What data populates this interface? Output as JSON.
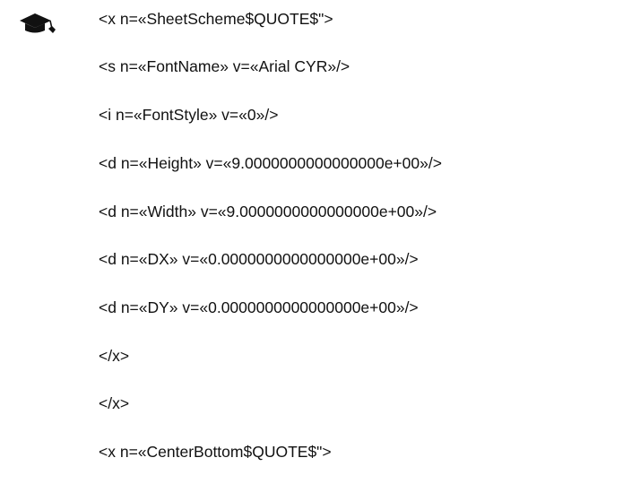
{
  "document": {
    "icon": "graduation-cap-icon",
    "lines": [
      "<x n=«SheetScheme$QUOTE$\">",
      "<s n=«FontName» v=«Arial CYR»/>",
      "<i n=«FontStyle» v=«0»/>",
      "<d n=«Height» v=«9.0000000000000000e+00»/>",
      "<d n=«Width» v=«9.0000000000000000e+00»/>",
      "<d n=«DX» v=«0.0000000000000000e+00»/>",
      "<d n=«DY» v=«0.0000000000000000e+00»/>",
      "</x>",
      "</x>",
      "<x n=«CenterBottom$QUOTE$\">"
    ]
  }
}
